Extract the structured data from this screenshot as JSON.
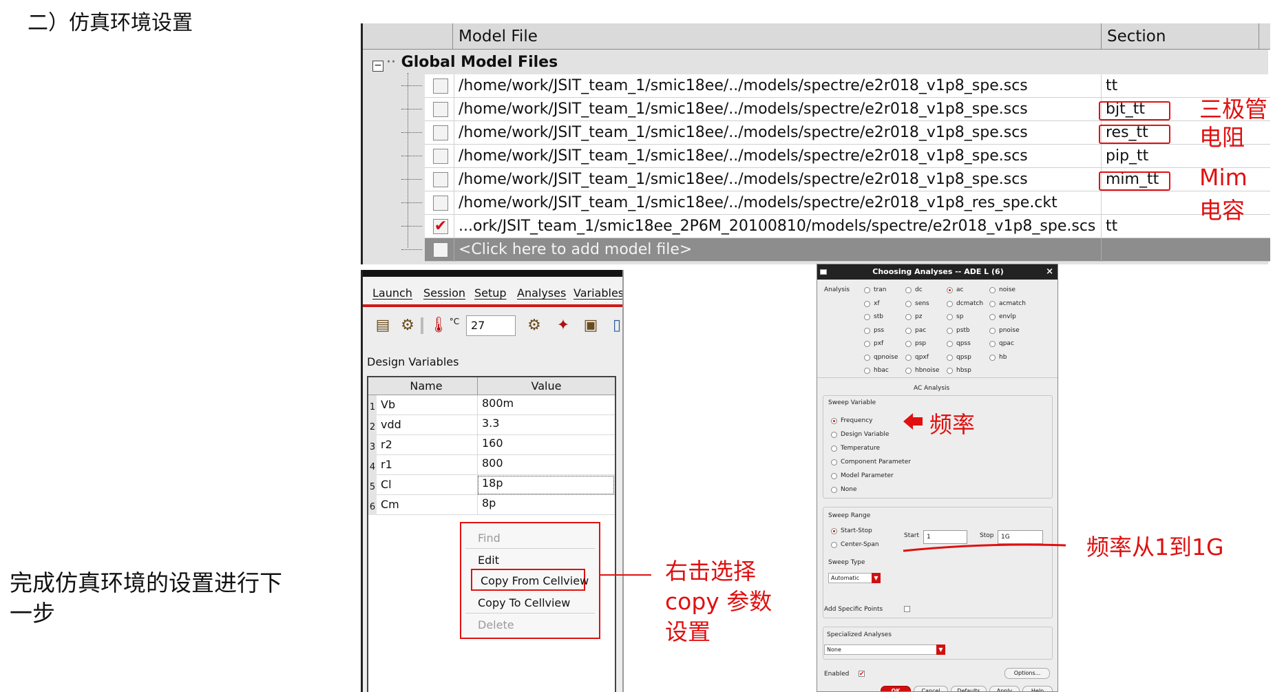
{
  "slide": {
    "heading": "二）仿真环境设置",
    "note": "完成仿真环境的设置进行下一步"
  },
  "model_files": {
    "col_file": "Model File",
    "col_section": "Section",
    "group_label": "Global Model Files",
    "rows": [
      {
        "path": "/home/work/JSIT_team_1/smic18ee/../models/spectre/e2r018_v1p8_spe.scs",
        "section": "tt",
        "checked": ""
      },
      {
        "path": "/home/work/JSIT_team_1/smic18ee/../models/spectre/e2r018_v1p8_spe.scs",
        "section": "bjt_tt",
        "checked": ""
      },
      {
        "path": "/home/work/JSIT_team_1/smic18ee/../models/spectre/e2r018_v1p8_spe.scs",
        "section": "res_tt",
        "checked": ""
      },
      {
        "path": "/home/work/JSIT_team_1/smic18ee/../models/spectre/e2r018_v1p8_spe.scs",
        "section": "pip_tt",
        "checked": ""
      },
      {
        "path": "/home/work/JSIT_team_1/smic18ee/../models/spectre/e2r018_v1p8_spe.scs",
        "section": "mim_tt",
        "checked": ""
      },
      {
        "path": "/home/work/JSIT_team_1/smic18ee/../models/spectre/e2r018_v1p8_res_spe.ckt",
        "section": "",
        "checked": ""
      },
      {
        "path": "...ork/JSIT_team_1/smic18ee_2P6M_20100810/models/spectre/e2r018_v1p8_spe.scs",
        "section": "tt",
        "checked": "✔"
      }
    ],
    "add_row": "<Click here to add model file>"
  },
  "annotations": {
    "bjt": "三极管",
    "res": "电阻",
    "mim1": "Mim",
    "mim2": "电容",
    "copy": "右击选择\ncopy 参数\n设置",
    "freq": "频率",
    "freq_range": "频率从1到1G"
  },
  "ade": {
    "menu": [
      "Launch",
      "Session",
      "Setup",
      "Analyses",
      "Variables"
    ],
    "temperature": "27",
    "temp_unit": "°C",
    "design_vars_title": "Design Variables",
    "col_name": "Name",
    "col_value": "Value",
    "vars": [
      {
        "idx": "1",
        "name": "Vb",
        "value": "800m"
      },
      {
        "idx": "2",
        "name": "vdd",
        "value": "3.3"
      },
      {
        "idx": "3",
        "name": "r2",
        "value": "160"
      },
      {
        "idx": "4",
        "name": "r1",
        "value": "800"
      },
      {
        "idx": "5",
        "name": "Cl",
        "value": "18p"
      },
      {
        "idx": "6",
        "name": "Cm",
        "value": "8p"
      }
    ]
  },
  "context_menu": {
    "find": "Find",
    "edit": "Edit",
    "copy_from": "Copy From Cellview",
    "copy_to": "Copy To Cellview",
    "delete": "Delete"
  },
  "analyses_dialog": {
    "title": "Choosing Analyses -- ADE L (6)",
    "analysis_label": "Analysis",
    "analyses": [
      "tran",
      "dc",
      "ac",
      "noise",
      "xf",
      "sens",
      "dcmatch",
      "acmatch",
      "stb",
      "pz",
      "sp",
      "envlp",
      "pss",
      "pac",
      "pstb",
      "pnoise",
      "pxf",
      "psp",
      "qpss",
      "qpac",
      "qpnoise",
      "qpxf",
      "qpsp",
      "hb",
      "hbac",
      "hbnoise",
      "hbsp"
    ],
    "selected_analysis": "ac",
    "section_title": "AC Analysis",
    "sweep_variable_label": "Sweep Variable",
    "sweep_variables": [
      "Frequency",
      "Design Variable",
      "Temperature",
      "Component Parameter",
      "Model Parameter",
      "None"
    ],
    "sweep_range_label": "Sweep Range",
    "range_modes": [
      "Start-Stop",
      "Center-Span"
    ],
    "start_label": "Start",
    "start_value": "1",
    "stop_label": "Stop",
    "stop_value": "1G",
    "sweep_type_label": "Sweep Type",
    "sweep_type": "Automatic",
    "add_points_label": "Add Specific Points",
    "specialized_label": "Specialized Analyses",
    "specialized_value": "None",
    "enabled_label": "Enabled",
    "options_button": "Options...",
    "buttons": [
      "OK",
      "Cancel",
      "Defaults",
      "Apply",
      "Help"
    ]
  },
  "colors": {
    "annotation": "#e01010",
    "accent": "#d01010"
  }
}
